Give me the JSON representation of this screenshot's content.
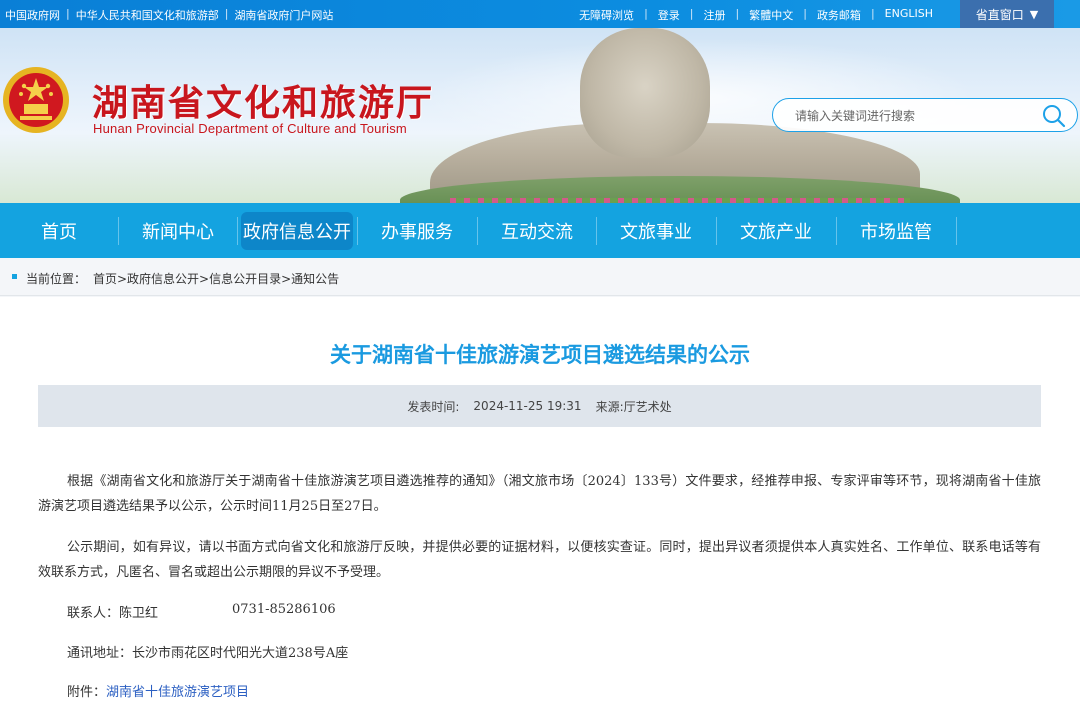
{
  "topbar": {
    "links_left": [
      "中国政府网",
      "中华人民共和国文化和旅游部",
      "湖南省政府门户网站"
    ],
    "links_right": [
      "无障碍浏览",
      "登录",
      "注册",
      "繁體中文",
      "政务邮箱",
      "ENGLISH"
    ],
    "portal_label": "省直窗口",
    "portal_arrow": "▼"
  },
  "header": {
    "title": "湖南省文化和旅游厅",
    "subtitle": "Hunan Provincial Department of Culture and Tourism",
    "emblem_icon": "national-emblem-icon",
    "brand_color": "#c8161d"
  },
  "search": {
    "placeholder": "请输入关键词进行搜索",
    "icon": "search-icon"
  },
  "nav": {
    "items": [
      "首页",
      "新闻中心",
      "政府信息公开",
      "办事服务",
      "互动交流",
      "文旅事业",
      "文旅产业",
      "市场监管"
    ],
    "active_index": 2,
    "color": "#14a3e0"
  },
  "breadcrumb": {
    "label": "当前位置：",
    "path": "首页>政府信息公开>信息公开目录>通知公告"
  },
  "article": {
    "title": "关于湖南省十佳旅游演艺项目遴选结果的公示",
    "publish_label": "发表时间:",
    "publish_time": "2024-11-25 19:31",
    "source": "来源:厅艺术处",
    "paragraphs": [
      "根据《湖南省文化和旅游厅关于湖南省十佳旅游演艺项目遴选推荐的通知》（湘文旅市场〔2024〕133号）文件要求，经推荐申报、专家评审等环节，现将湖南省十佳旅游演艺项目遴选结果予以公示，公示时间11月25日至27日。",
      "公示期间，如有异议，请以书面方式向省文化和旅游厅反映，并提供必要的证据材料，以便核实查证。同时，提出异议者须提供本人真实姓名、工作单位、联系电话等有效联系方式，凡匿名、冒名或超出公示期限的异议不予受理。"
    ],
    "contact_label": "联系人：陈卫红",
    "contact_phone": "0731-85286106",
    "address": "通讯地址：长沙市雨花区时代阳光大道238号A座",
    "attachment_label": "附件：",
    "attachment_link": "湖南省十佳旅游演艺项目"
  }
}
